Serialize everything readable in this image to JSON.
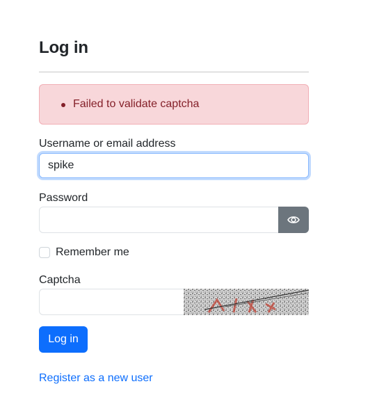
{
  "form": {
    "title": "Log in",
    "error_message": "Failed to validate captcha",
    "username": {
      "label": "Username or email address",
      "value": "spike"
    },
    "password": {
      "label": "Password",
      "value": "",
      "toggle_icon": "eye-icon"
    },
    "remember": {
      "label": "Remember me",
      "checked": false
    },
    "captcha": {
      "label": "Captcha",
      "value": ""
    },
    "submit_label": "Log in",
    "register_label": "Register as a new user"
  },
  "colors": {
    "primary": "#0d6efd",
    "alert_bg": "#f8d7da",
    "alert_text": "#842029",
    "secondary_button": "#6c757d"
  }
}
